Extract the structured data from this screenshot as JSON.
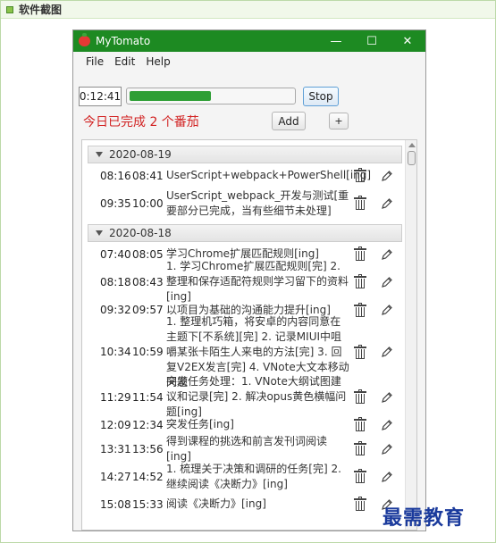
{
  "page": {
    "section_title": "软件截图"
  },
  "window": {
    "title": "MyTomato",
    "controls": {
      "minimize": "—",
      "maximize": "☐",
      "close": "✕"
    }
  },
  "menu": [
    "File",
    "Edit",
    "Help"
  ],
  "timer": {
    "time": "0:12:41",
    "progress": 0.5,
    "stop_label": "Stop"
  },
  "summary": {
    "done_text": "今日已完成 2 个番茄",
    "add_label": "Add",
    "plus_label": "+"
  },
  "groups": [
    {
      "date": "2020-08-19",
      "tasks": [
        {
          "start": "08:16",
          "end": "08:41",
          "desc": "UserScript+webpack+PowerShell[ing]"
        },
        {
          "start": "09:35",
          "end": "10:00",
          "desc": "UserScript_webpack_开发与测试[重要部分已完成，当有些细节未处理]"
        }
      ]
    },
    {
      "date": "2020-08-18",
      "tasks": [
        {
          "start": "07:40",
          "end": "08:05",
          "desc": "学习Chrome扩展匹配规则[ing]"
        },
        {
          "start": "08:18",
          "end": "08:43",
          "desc": "1. 学习Chrome扩展匹配规则[完] 2. 整理和保存适配符规则学习留下的资料[ing]"
        },
        {
          "start": "09:32",
          "end": "09:57",
          "desc": "以项目为基础的沟通能力提升[ing]"
        },
        {
          "start": "10:34",
          "end": "10:59",
          "desc": "1. 整理机巧箱，将安卓的内容同意在主题下[不系统][完] 2. 记录MIUI中咀嚼某张卡陌生人来电的方法[完] 3. 回复V2EX发言[完] 4. VNote大文本移动问题"
        },
        {
          "start": "11:29",
          "end": "11:54",
          "desc": "突发任务处理：1. VNote大纲试图建议和记录[完] 2. 解决opus黄色横幅问题[ing]"
        },
        {
          "start": "12:09",
          "end": "12:34",
          "desc": "突发任务[ing]"
        },
        {
          "start": "13:31",
          "end": "13:56",
          "desc": "得到课程的挑选和前言发刊词阅读[ing]"
        },
        {
          "start": "14:27",
          "end": "14:52",
          "desc": "1. 梳理关于决策和调研的任务[完] 2. 继续阅读《决断力》[ing]"
        },
        {
          "start": "15:08",
          "end": "15:33",
          "desc": "阅读《决断力》[ing]"
        }
      ]
    }
  ],
  "watermark": "最需教育"
}
